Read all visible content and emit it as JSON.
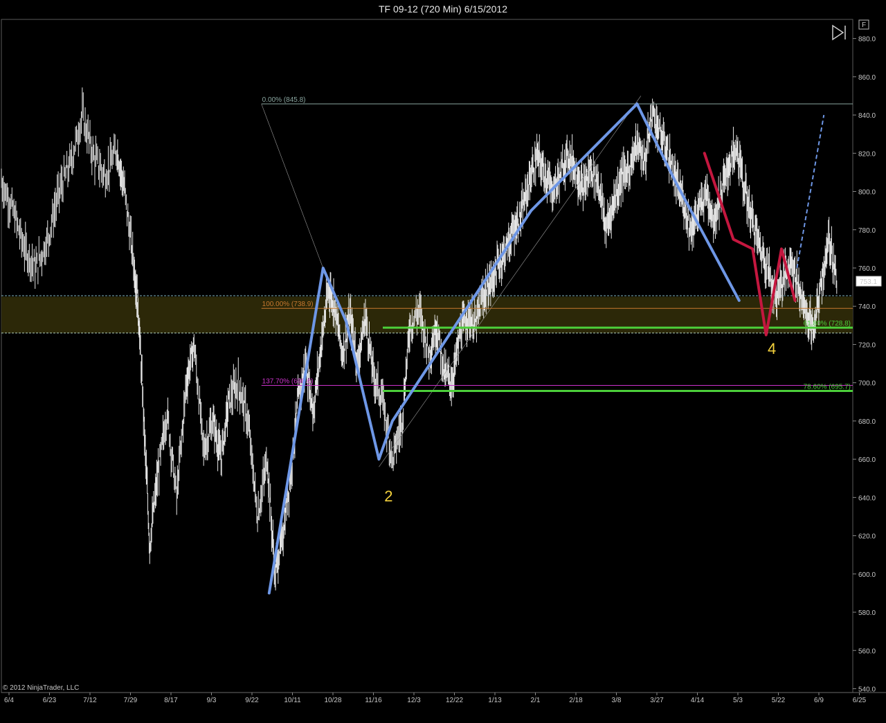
{
  "window": {
    "title": "TF 09-12 (720 Min)  6/15/2012",
    "f_button_label": "F",
    "copyright": "© 2012 NinjaTrader, LLC"
  },
  "colors": {
    "background": "#000000",
    "price_bars": "#e8e8e8",
    "wave_blue": "#6e97e6",
    "wave_red": "#c4173f",
    "fib_green": "#4ccf3a",
    "fib_orange": "#c8792f",
    "fib_magenta": "#cc33cc",
    "zone_fill": "#2e2a08",
    "wave_label": "#f5d23c"
  },
  "chart_data": {
    "type": "line",
    "title": "TF 09-12 (720 Min)  6/15/2012",
    "x_ticks": [
      "6/4",
      "6/23",
      "7/12",
      "7/29",
      "8/17",
      "9/3",
      "9/22",
      "10/11",
      "10/28",
      "11/16",
      "12/3",
      "12/22",
      "1/13",
      "2/1",
      "2/18",
      "3/8",
      "3/27",
      "4/14",
      "5/3",
      "5/22",
      "6/9",
      "6/25"
    ],
    "y_ticks": [
      880,
      860,
      840,
      820,
      800,
      780,
      760,
      740,
      720,
      700,
      680,
      660,
      640,
      620,
      600,
      580,
      560,
      540
    ],
    "y_tick_labels": [
      "880.0",
      "860.0",
      "840.0",
      "820.0",
      "800.0",
      "780.0",
      "760.0",
      "740.0",
      "720.0",
      "700.0",
      "680.0",
      "660.0",
      "640.0",
      "620.0",
      "600.0",
      "580.0",
      "560.0",
      "540.0"
    ],
    "ylim": [
      538,
      890
    ],
    "grid": false,
    "last_price": 753.1,
    "last_price_label": "753.1",
    "price_series": [
      {
        "t": 0,
        "c": 805
      },
      {
        "t": 0.6,
        "c": 790
      },
      {
        "t": 1.2,
        "c": 770
      },
      {
        "t": 1.8,
        "c": 760
      },
      {
        "t": 2.4,
        "c": 775
      },
      {
        "t": 3.0,
        "c": 800
      },
      {
        "t": 3.6,
        "c": 815
      },
      {
        "t": 4.2,
        "c": 840
      },
      {
        "t": 4.8,
        "c": 818
      },
      {
        "t": 5.4,
        "c": 808
      },
      {
        "t": 6.0,
        "c": 822
      },
      {
        "t": 6.4,
        "c": 800
      },
      {
        "t": 6.9,
        "c": 760
      },
      {
        "t": 7.1,
        "c": 740
      },
      {
        "t": 7.4,
        "c": 680
      },
      {
        "t": 7.7,
        "c": 615
      },
      {
        "t": 8.1,
        "c": 650
      },
      {
        "t": 8.6,
        "c": 685
      },
      {
        "t": 9.1,
        "c": 640
      },
      {
        "t": 9.6,
        "c": 700
      },
      {
        "t": 10.0,
        "c": 720
      },
      {
        "t": 10.5,
        "c": 665
      },
      {
        "t": 11.0,
        "c": 680
      },
      {
        "t": 11.4,
        "c": 660
      },
      {
        "t": 11.8,
        "c": 690
      },
      {
        "t": 12.3,
        "c": 700
      },
      {
        "t": 12.8,
        "c": 680
      },
      {
        "t": 13.3,
        "c": 630
      },
      {
        "t": 13.8,
        "c": 660
      },
      {
        "t": 14.2,
        "c": 600
      },
      {
        "t": 14.6,
        "c": 620
      },
      {
        "t": 15.0,
        "c": 650
      },
      {
        "t": 15.4,
        "c": 690
      },
      {
        "t": 15.8,
        "c": 710
      },
      {
        "t": 16.2,
        "c": 685
      },
      {
        "t": 16.6,
        "c": 720
      },
      {
        "t": 17.0,
        "c": 750
      },
      {
        "t": 17.3,
        "c": 740
      },
      {
        "t": 17.7,
        "c": 715
      },
      {
        "t": 18.1,
        "c": 735
      },
      {
        "t": 18.5,
        "c": 710
      },
      {
        "t": 18.9,
        "c": 735
      },
      {
        "t": 19.3,
        "c": 705
      },
      {
        "t": 19.8,
        "c": 690
      },
      {
        "t": 20.3,
        "c": 660
      },
      {
        "t": 20.8,
        "c": 680
      },
      {
        "t": 21.2,
        "c": 730
      },
      {
        "t": 21.7,
        "c": 738
      },
      {
        "t": 22.2,
        "c": 715
      },
      {
        "t": 22.6,
        "c": 730
      },
      {
        "t": 23.0,
        "c": 705
      },
      {
        "t": 23.4,
        "c": 700
      },
      {
        "t": 23.8,
        "c": 725
      },
      {
        "t": 24.2,
        "c": 735
      },
      {
        "t": 24.6,
        "c": 730
      },
      {
        "t": 25.0,
        "c": 745
      },
      {
        "t": 25.4,
        "c": 752
      },
      {
        "t": 25.8,
        "c": 762
      },
      {
        "t": 26.2,
        "c": 770
      },
      {
        "t": 26.6,
        "c": 780
      },
      {
        "t": 27.0,
        "c": 788
      },
      {
        "t": 27.4,
        "c": 805
      },
      {
        "t": 27.8,
        "c": 818
      },
      {
        "t": 28.2,
        "c": 810
      },
      {
        "t": 28.6,
        "c": 800
      },
      {
        "t": 29.0,
        "c": 808
      },
      {
        "t": 29.4,
        "c": 820
      },
      {
        "t": 29.8,
        "c": 812
      },
      {
        "t": 30.2,
        "c": 800
      },
      {
        "t": 30.6,
        "c": 812
      },
      {
        "t": 31.0,
        "c": 805
      },
      {
        "t": 31.4,
        "c": 780
      },
      {
        "t": 31.8,
        "c": 795
      },
      {
        "t": 32.2,
        "c": 808
      },
      {
        "t": 32.6,
        "c": 812
      },
      {
        "t": 33.0,
        "c": 825
      },
      {
        "t": 33.4,
        "c": 815
      },
      {
        "t": 33.8,
        "c": 842
      },
      {
        "t": 34.2,
        "c": 830
      },
      {
        "t": 34.6,
        "c": 820
      },
      {
        "t": 35.0,
        "c": 805
      },
      {
        "t": 35.4,
        "c": 795
      },
      {
        "t": 35.8,
        "c": 780
      },
      {
        "t": 36.2,
        "c": 790
      },
      {
        "t": 36.6,
        "c": 800
      },
      {
        "t": 37.0,
        "c": 785
      },
      {
        "t": 37.4,
        "c": 800
      },
      {
        "t": 37.8,
        "c": 815
      },
      {
        "t": 38.2,
        "c": 822
      },
      {
        "t": 38.6,
        "c": 800
      },
      {
        "t": 39.0,
        "c": 785
      },
      {
        "t": 39.4,
        "c": 770
      },
      {
        "t": 39.8,
        "c": 760
      },
      {
        "t": 40.2,
        "c": 745
      },
      {
        "t": 40.6,
        "c": 755
      },
      {
        "t": 41.0,
        "c": 765
      },
      {
        "t": 41.4,
        "c": 750
      },
      {
        "t": 41.8,
        "c": 735
      },
      {
        "t": 42.2,
        "c": 728
      },
      {
        "t": 42.6,
        "c": 755
      },
      {
        "t": 43.0,
        "c": 775
      },
      {
        "t": 43.4,
        "c": 752
      }
    ],
    "wave_lines": [
      {
        "color": "blue",
        "points": [
          [
            13.9,
            590
          ],
          [
            16.7,
            760
          ],
          [
            17.9,
            732
          ],
          [
            19.6,
            660
          ],
          [
            20.3,
            680
          ],
          [
            27.5,
            790
          ],
          [
            33.0,
            845.8
          ],
          [
            35.0,
            805
          ],
          [
            38.3,
            743
          ]
        ]
      },
      {
        "color": "red",
        "points": [
          [
            36.5,
            820
          ],
          [
            38.0,
            775
          ],
          [
            39.0,
            770
          ],
          [
            39.7,
            725
          ],
          [
            40.5,
            770
          ],
          [
            41.2,
            743
          ]
        ]
      }
    ],
    "projection": {
      "color": "blue",
      "dashed": true,
      "points": [
        [
          41.3,
          760
        ],
        [
          42.7,
          840
        ]
      ]
    },
    "fib_lines": [
      {
        "label": "0.00% (845.8)",
        "value": 845.8,
        "color": "#8aa6a0",
        "start_t": 13.5
      },
      {
        "label": "100.00% (738.9)",
        "value": 738.9,
        "color": "#c8792f",
        "start_t": 13.5
      },
      {
        "label": "137.70% (698.6)",
        "value": 698.6,
        "color": "#cc33cc",
        "start_t": 13.5
      },
      {
        "label": "61.80% (728.8)",
        "value": 728.8,
        "color": "#4ccf3a",
        "start_t": 19.8,
        "thick": true
      },
      {
        "label": "78.60% (695.7)",
        "value": 695.7,
        "color": "#4ccf3a",
        "start_t": 19.8,
        "thick": true
      }
    ],
    "zone": {
      "low": 726,
      "high": 745
    },
    "wave_labels": [
      {
        "text": "2",
        "t": 20.1,
        "value": 638
      },
      {
        "text": "4",
        "t": 40.0,
        "value": 715
      }
    ]
  }
}
